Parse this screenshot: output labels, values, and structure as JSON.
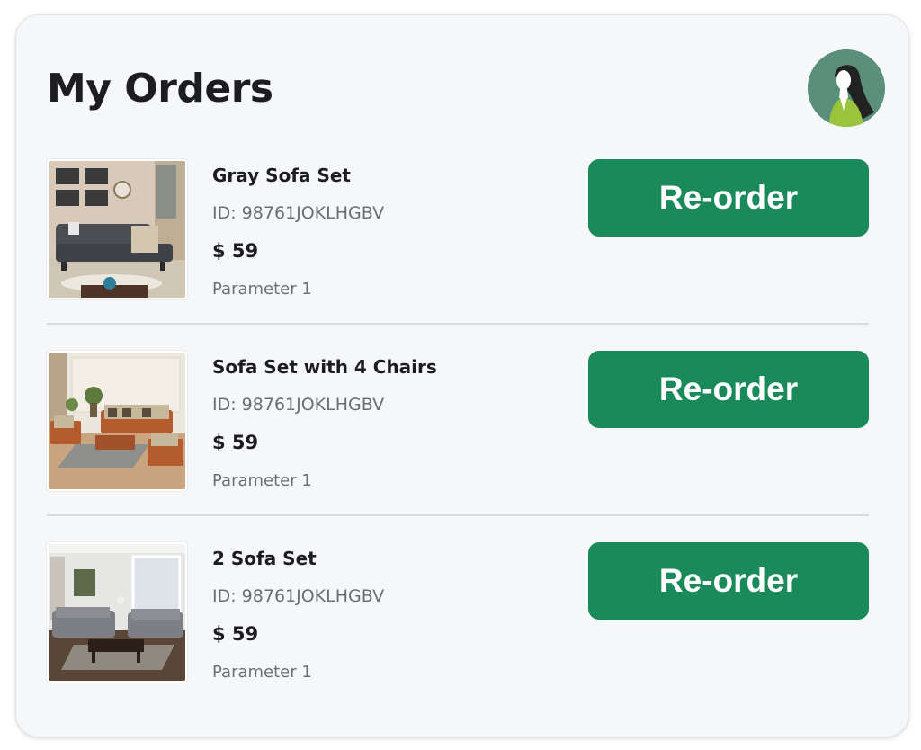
{
  "page": {
    "title": "My Orders"
  },
  "colors": {
    "accent": "#1b8a5a",
    "background": "#f6f7f9"
  },
  "avatar": {
    "icon": "user-avatar-icon"
  },
  "orders": [
    {
      "name": "Gray Sofa Set",
      "id": "ID: 98761JOKLHGBV",
      "price": "$ 59",
      "parameter": "Parameter 1",
      "button_label": "Re-order",
      "image": "gray-sofa-living-room-image"
    },
    {
      "name": "Sofa Set with 4 Chairs",
      "id": "ID: 98761JOKLHGBV",
      "price": "$ 59",
      "parameter": "Parameter 1",
      "button_label": "Re-order",
      "image": "wooden-sofa-set-image"
    },
    {
      "name": "2 Sofa Set",
      "id": "ID: 98761JOKLHGBV",
      "price": "$ 59",
      "parameter": "Parameter 1",
      "button_label": "Re-order",
      "image": "two-sofa-set-image"
    }
  ]
}
